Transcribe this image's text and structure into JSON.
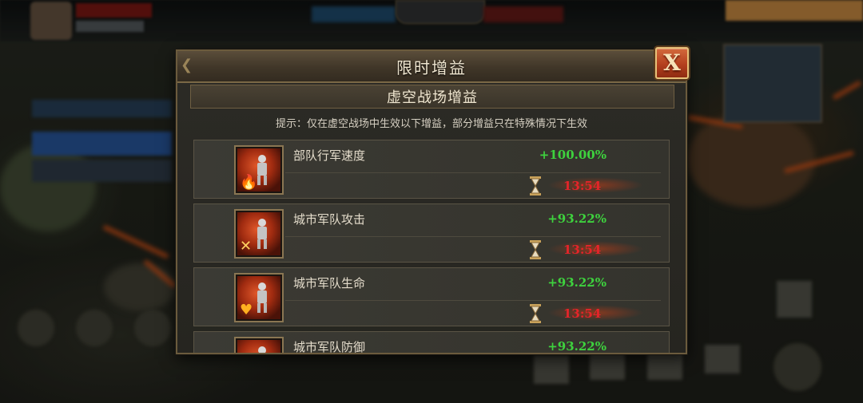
{
  "dialog": {
    "title": "限时增益",
    "close_label": "X",
    "subtitle": "虚空战场增益",
    "hint": "提示：仅在虚空战场中生效以下增益，部分增益只在特殊情况下生效"
  },
  "buffs": [
    {
      "name": "部队行军速度",
      "value": "+100.00%",
      "timer": "13:54",
      "icon": "march-speed-icon"
    },
    {
      "name": "城市军队攻击",
      "value": "+93.22%",
      "timer": "13:54",
      "icon": "attack-icon"
    },
    {
      "name": "城市军队生命",
      "value": "+93.22%",
      "timer": "13:54",
      "icon": "health-icon"
    },
    {
      "name": "城市军队防御",
      "value": "+93.22%",
      "timer": "",
      "icon": "defense-icon"
    }
  ],
  "colors": {
    "value_green": "#3ed23e",
    "timer_red": "#e5242a",
    "close_button": "#b4401e"
  }
}
